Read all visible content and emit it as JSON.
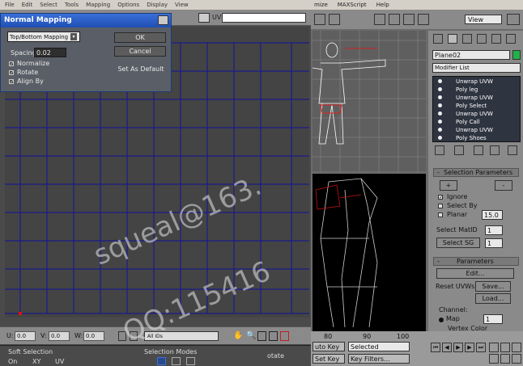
{
  "uv_editor": {
    "menu": [
      "File",
      "Edit",
      "Select",
      "Tools",
      "Mapping",
      "Options",
      "Display",
      "View"
    ],
    "toolbar_label": "UV",
    "coord_labels": [
      "U:",
      "V:",
      "W:"
    ],
    "coord_values": [
      "0.0",
      "0.0",
      "0.0"
    ],
    "filter_dropdown": "All IDs",
    "soft_selection_title": "Soft Selection",
    "soft_on_label": "On",
    "soft_xy_label": "XY",
    "soft_uv_label": "UV",
    "selection_modes_title": "Selection Modes",
    "rotate_label": "otate"
  },
  "dialog": {
    "title": "Normal Mapping",
    "mapping_type": "Top/Bottom Mapping",
    "spacing_label": "Spacing:",
    "spacing_value": "0.02",
    "options": [
      {
        "label": "Normalize",
        "checked": true
      },
      {
        "label": "Rotate",
        "checked": true
      },
      {
        "label": "Align By",
        "checked": true
      }
    ],
    "ok_label": "OK",
    "cancel_label": "Cancel",
    "default_label": "Set As Default"
  },
  "max": {
    "menu": [
      "mize",
      "MAXScript",
      "Help"
    ],
    "view_dropdown": "View",
    "object_name": "Plane02",
    "object_color": "#22b04a",
    "modifier_list": "Modifier List",
    "stack": [
      "Unwrap UVW",
      "Poly leg",
      "Unwrap UVW",
      "Poly Select",
      "Unwrap UVW",
      "Poly Call",
      "Unwrap UVW",
      "Poly Shoes"
    ],
    "sel_params_title": "Selection Parameters",
    "ignore_label": "Ignore",
    "select_by_label": "Select By",
    "planar_label": "Planar",
    "planar_value": "15.0",
    "select_matid_label": "Select MatID",
    "select_matid_value": "1",
    "select_sg_label": "Select SG",
    "select_sg_value": "1",
    "parameters_title": "Parameters",
    "edit_label": "Edit...",
    "reset_uvws_label": "Reset UVWs",
    "save_label": "Save...",
    "load_label": "Load...",
    "channel_label": "Channel:",
    "map_label": "Map",
    "map_value": "1",
    "vertex_color_label": "Vertex Color",
    "plus": "+",
    "minus": "-"
  },
  "timeline": {
    "ticks": [
      "80",
      "90",
      "100"
    ],
    "auto_key": "uto Key",
    "selected": "Selected",
    "set_key": "Set Key",
    "key_filters": "Key Filters..."
  },
  "watermark": {
    "line1": "squeal@163.",
    "line2": "QQ:115416"
  }
}
